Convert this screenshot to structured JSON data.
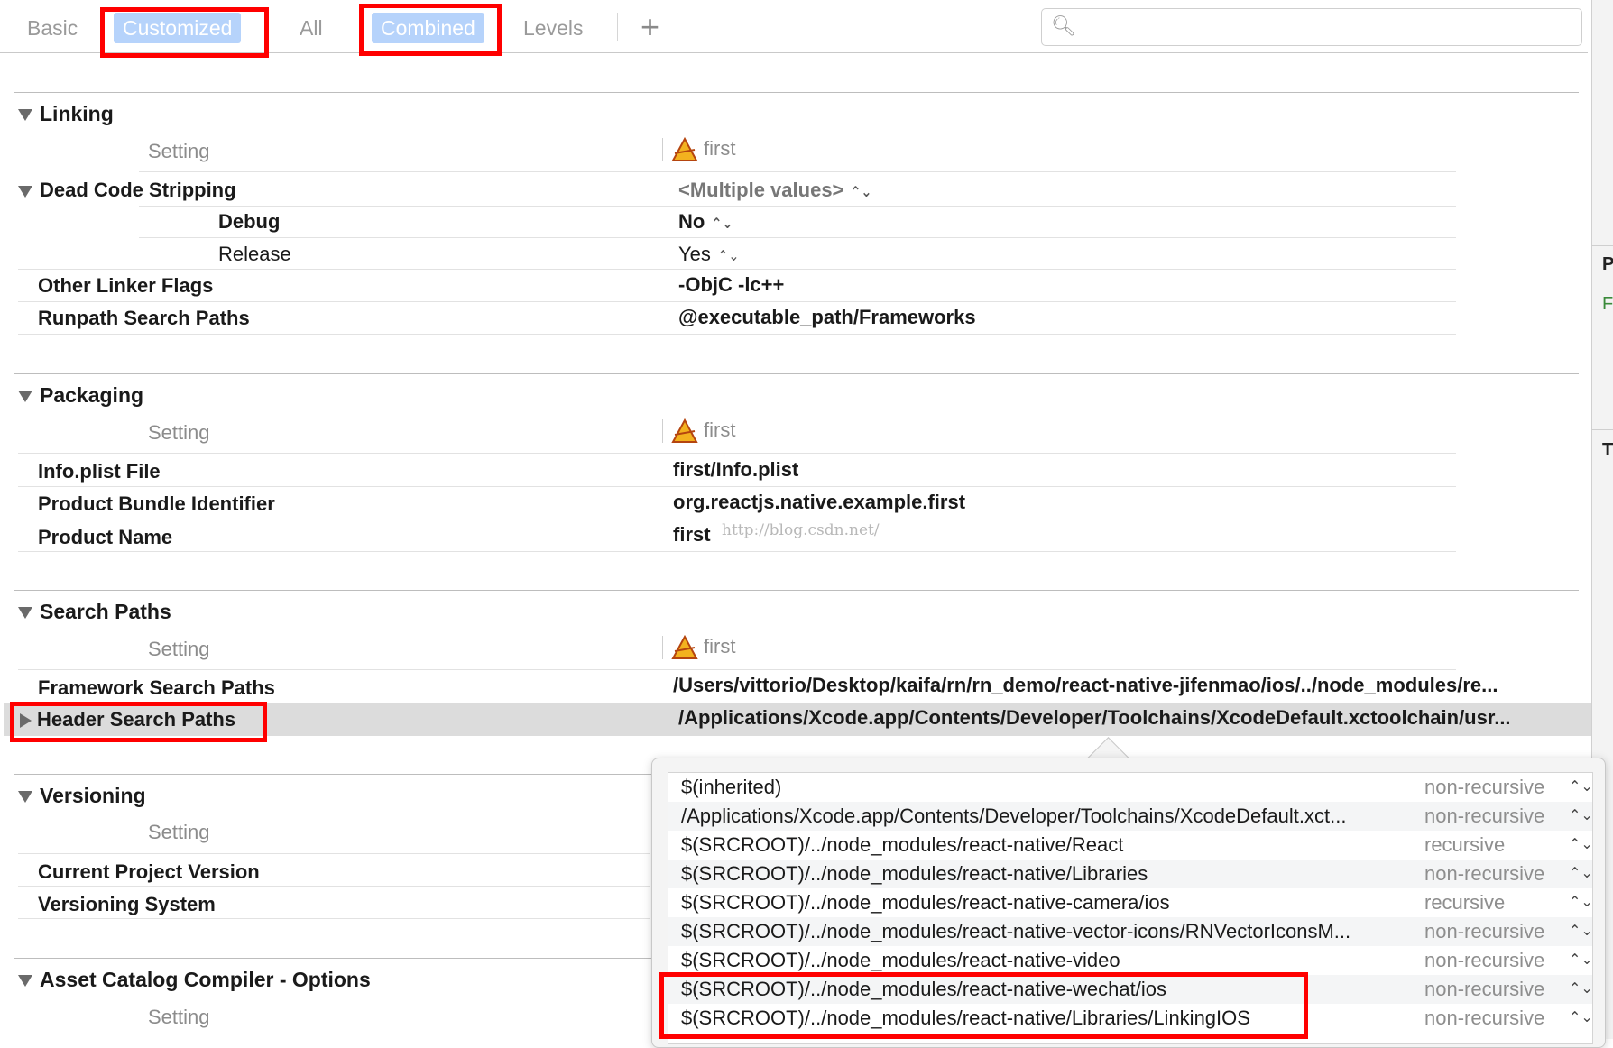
{
  "tabs": [
    {
      "label": "Basic",
      "selected": false
    },
    {
      "label": "Customized",
      "selected": true
    },
    {
      "label": "All",
      "selected": false
    },
    {
      "label": "Combined",
      "selected": true
    },
    {
      "label": "Levels",
      "selected": false
    }
  ],
  "add_label": "+",
  "search": {
    "placeholder": "",
    "icon": "search-icon"
  },
  "column_setting": "Setting",
  "target_name": "first",
  "sections": {
    "linking": {
      "title": "Linking",
      "dead_code_stripping": {
        "label": "Dead Code Stripping",
        "value": "<Multiple values>"
      },
      "debug": {
        "label": "Debug",
        "value": "No"
      },
      "release": {
        "label": "Release",
        "value": "Yes"
      },
      "other_linker_flags": {
        "label": "Other Linker Flags",
        "value": "-ObjC -lc++"
      },
      "runpath_search_paths": {
        "label": "Runpath Search Paths",
        "value": "@executable_path/Frameworks"
      }
    },
    "packaging": {
      "title": "Packaging",
      "info_plist": {
        "label": "Info.plist File",
        "value": "first/Info.plist"
      },
      "bundle_id": {
        "label": "Product Bundle Identifier",
        "value": "org.reactjs.native.example.first"
      },
      "product_name": {
        "label": "Product Name",
        "value": "first"
      }
    },
    "search_paths": {
      "title": "Search Paths",
      "framework_search_paths": {
        "label": "Framework Search Paths",
        "value": "/Users/vittorio/Desktop/kaifa/rn/rn_demo/react-native-jifenmao/ios/../node_modules/re..."
      },
      "header_search_paths": {
        "label": "Header Search Paths",
        "value": "/Applications/Xcode.app/Contents/Developer/Toolchains/XcodeDefault.xctoolchain/usr..."
      }
    },
    "versioning": {
      "title": "Versioning",
      "current_project_version": {
        "label": "Current Project Version"
      },
      "versioning_system": {
        "label": "Versioning System"
      }
    },
    "asset_catalog": {
      "title": "Asset Catalog Compiler - Options"
    }
  },
  "watermark": "http://blog.csdn.net/",
  "gutter_chars": [
    "P",
    "F",
    "T"
  ],
  "header_paths_popover": [
    {
      "path": "$(inherited)",
      "mode": "non-recursive"
    },
    {
      "path": "/Applications/Xcode.app/Contents/Developer/Toolchains/XcodeDefault.xct...",
      "mode": "non-recursive"
    },
    {
      "path": "$(SRCROOT)/../node_modules/react-native/React",
      "mode": "recursive"
    },
    {
      "path": "$(SRCROOT)/../node_modules/react-native/Libraries",
      "mode": "non-recursive"
    },
    {
      "path": "$(SRCROOT)/../node_modules/react-native-camera/ios",
      "mode": "recursive"
    },
    {
      "path": "$(SRCROOT)/../node_modules/react-native-vector-icons/RNVectorIconsM...",
      "mode": "non-recursive"
    },
    {
      "path": "$(SRCROOT)/../node_modules/react-native-video",
      "mode": "non-recursive"
    },
    {
      "path": "$(SRCROOT)/../node_modules/react-native-wechat/ios",
      "mode": "non-recursive"
    },
    {
      "path": "$(SRCROOT)/../node_modules/react-native/Libraries/LinkingIOS",
      "mode": "non-recursive"
    }
  ],
  "stepper_glyph": "⌃⌄",
  "colors": {
    "selected_tab": "#b6d3fb",
    "highlight": "#ff0000",
    "row_selected": "#dcdcdc"
  }
}
